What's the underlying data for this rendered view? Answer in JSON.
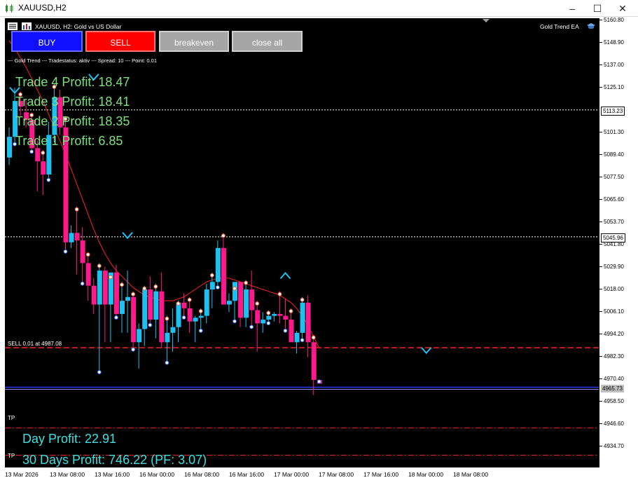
{
  "window": {
    "title": "XAUUSD,H2",
    "icon": "chart-bars-icon",
    "controls": [
      "–",
      "☐",
      "✕"
    ]
  },
  "chart": {
    "symbol_info": "XAUUSD, H2:  Gold vs US Dollar",
    "ea_name": "Gold Trend EA",
    "ea_icon": "graduation-cap-icon",
    "status_line": "--- Gold Trend --- Tradestatus: aktiv --- Spread: 10 --- Point: 0.01",
    "sell_label": "SELL 0.01 at 4987.08",
    "tp_label": "TP"
  },
  "buttons": {
    "buy": "BUY",
    "sell": "SELL",
    "breakeven": "breakeven",
    "close_all": "close all"
  },
  "trade_profits": [
    "Trade 4 Profit: 18.47",
    "Trade 3 Profit: 18.41",
    "Trade 2 Profit: 18.35",
    "Trade 1 Profit: 6.85"
  ],
  "summary": {
    "day_profit": "Day Profit: 22.91",
    "thirty_days_profit": "30 Days Profit: 746.22 (PF: 3.07)"
  },
  "price_axis": {
    "ticks": [
      "5160.80",
      "5148.90",
      "5137.00",
      "5125.10",
      "5113.23",
      "5101.30",
      "5089.40",
      "5077.50",
      "5065.60",
      "5053.70",
      "5045.96",
      "5041.80",
      "5029.90",
      "5018.00",
      "5006.10",
      "4994.20",
      "4982.30",
      "4970.40",
      "4965.73",
      "4958.50",
      "4946.60",
      "4934.70"
    ],
    "labels": [
      "5113.23",
      "5045.96",
      "4965.73"
    ]
  },
  "time_axis": {
    "ticks": [
      "13 Mar 2026",
      "13 Mar 08:00",
      "13 Mar 16:00",
      "16 Mar 00:00",
      "16 Mar 08:00",
      "16 Mar 16:00",
      "17 Mar 00:00",
      "17 Mar 08:00",
      "17 Mar 16:00",
      "18 Mar 00:00",
      "18 Mar 08:00"
    ]
  },
  "colors": {
    "bull": "#1ec0f0",
    "bear": "#ff1a8c",
    "ma": "#ff2020",
    "sell_line": "#ff2020",
    "bid_line": "#2a3cff",
    "trade_text": "#7de07d",
    "summary_text": "#3de0e0"
  },
  "chart_data": {
    "type": "candlestick",
    "x_label_format": "H2 bars",
    "ohlc": [
      [
        5088,
        5104,
        5084,
        5099
      ],
      [
        5099,
        5125,
        5094,
        5118
      ],
      [
        5118,
        5123,
        5110,
        5115
      ],
      [
        5112,
        5118,
        5104,
        5108
      ],
      [
        5108,
        5112,
        5090,
        5093
      ],
      [
        5093,
        5097,
        5070,
        5086
      ],
      [
        5086,
        5092,
        5068,
        5079
      ],
      [
        5079,
        5107,
        5075,
        5100
      ],
      [
        5100,
        5127,
        5096,
        5120
      ],
      [
        5120,
        5124,
        5100,
        5104
      ],
      [
        5104,
        5110,
        5037,
        5043
      ],
      [
        5043,
        5052,
        5040,
        5048
      ],
      [
        5048,
        5062,
        5026,
        5044
      ],
      [
        5044,
        5051,
        5020,
        5032
      ],
      [
        5032,
        5038,
        5012,
        5020
      ],
      [
        5020,
        5024,
        5005,
        5010
      ],
      [
        5010,
        5032,
        4973,
        5028
      ],
      [
        5028,
        5030,
        4990,
        5010
      ],
      [
        5010,
        5026,
        4990,
        5027
      ],
      [
        5027,
        5031,
        5002,
        5005
      ],
      [
        5005,
        5022,
        4995,
        5012
      ],
      [
        5012,
        5028,
        4995,
        5014
      ],
      [
        5014,
        5017,
        4985,
        4990
      ],
      [
        4990,
        5000,
        4976,
        4997
      ],
      [
        4997,
        5020,
        4988,
        5018
      ],
      [
        5018,
        5025,
        4998,
        5002
      ],
      [
        5002,
        5021,
        4992,
        5017
      ],
      [
        5017,
        5027,
        4987,
        4990
      ],
      [
        4990,
        5004,
        4978,
        4995
      ],
      [
        4995,
        5008,
        4985,
        4998
      ],
      [
        4998,
        5012,
        4990,
        5011
      ],
      [
        5011,
        5016,
        5002,
        5008
      ],
      [
        5008,
        5014,
        4995,
        5001
      ],
      [
        5001,
        5004,
        4990,
        5003
      ],
      [
        5003,
        5008,
        4995,
        5004
      ],
      [
        5004,
        5021,
        5000,
        5018
      ],
      [
        5018,
        5027,
        5008,
        5022
      ],
      [
        5022,
        5044,
        5018,
        5040
      ],
      [
        5040,
        5048,
        5010,
        5010
      ],
      [
        5010,
        5016,
        5006,
        5012
      ],
      [
        5012,
        5020,
        5000,
        5022
      ],
      [
        5022,
        5016,
        4998,
        5003
      ],
      [
        5003,
        5023,
        4998,
        5018
      ],
      [
        5018,
        5028,
        4997,
        5007
      ],
      [
        5007,
        5012,
        4985,
        5000
      ],
      [
        5000,
        5006,
        4995,
        5002
      ],
      [
        5002,
        5007,
        4999,
        5004
      ],
      [
        5004,
        5006,
        5001,
        5005
      ],
      [
        5005,
        5017,
        5000,
        5004
      ],
      [
        5004,
        5013,
        4995,
        5002
      ],
      [
        5002,
        5008,
        4990,
        4990
      ],
      [
        4990,
        4996,
        4984,
        4995
      ],
      [
        4995,
        5014,
        4990,
        5011
      ],
      [
        5011,
        5015,
        4982,
        4990
      ],
      [
        4990,
        4994,
        4962,
        4970
      ],
      [
        4970,
        4970,
        4968,
        4968
      ]
    ],
    "ma_series": [
      5150,
      5146,
      5141,
      5136,
      5130,
      5124,
      5118,
      5111,
      5104,
      5097,
      5090,
      5082,
      5074,
      5066,
      5058,
      5050,
      5043,
      5037,
      5032,
      5028,
      5025,
      5022,
      5019,
      5017,
      5015,
      5014,
      5013,
      5012,
      5012,
      5012,
      5013,
      5014,
      5016,
      5018,
      5020,
      5022,
      5023,
      5024,
      5024,
      5024,
      5023,
      5022,
      5021,
      5020,
      5019,
      5018,
      5017,
      5016,
      5015,
      5013,
      5011,
      5008,
      5004,
      4999,
      4993,
      4987
    ],
    "sell_price": 4987.08,
    "bid_price": 4965.73,
    "levels": [
      5113.23,
      5045.96
    ],
    "tp_levels": [
      4944.5,
      4930.0
    ]
  }
}
